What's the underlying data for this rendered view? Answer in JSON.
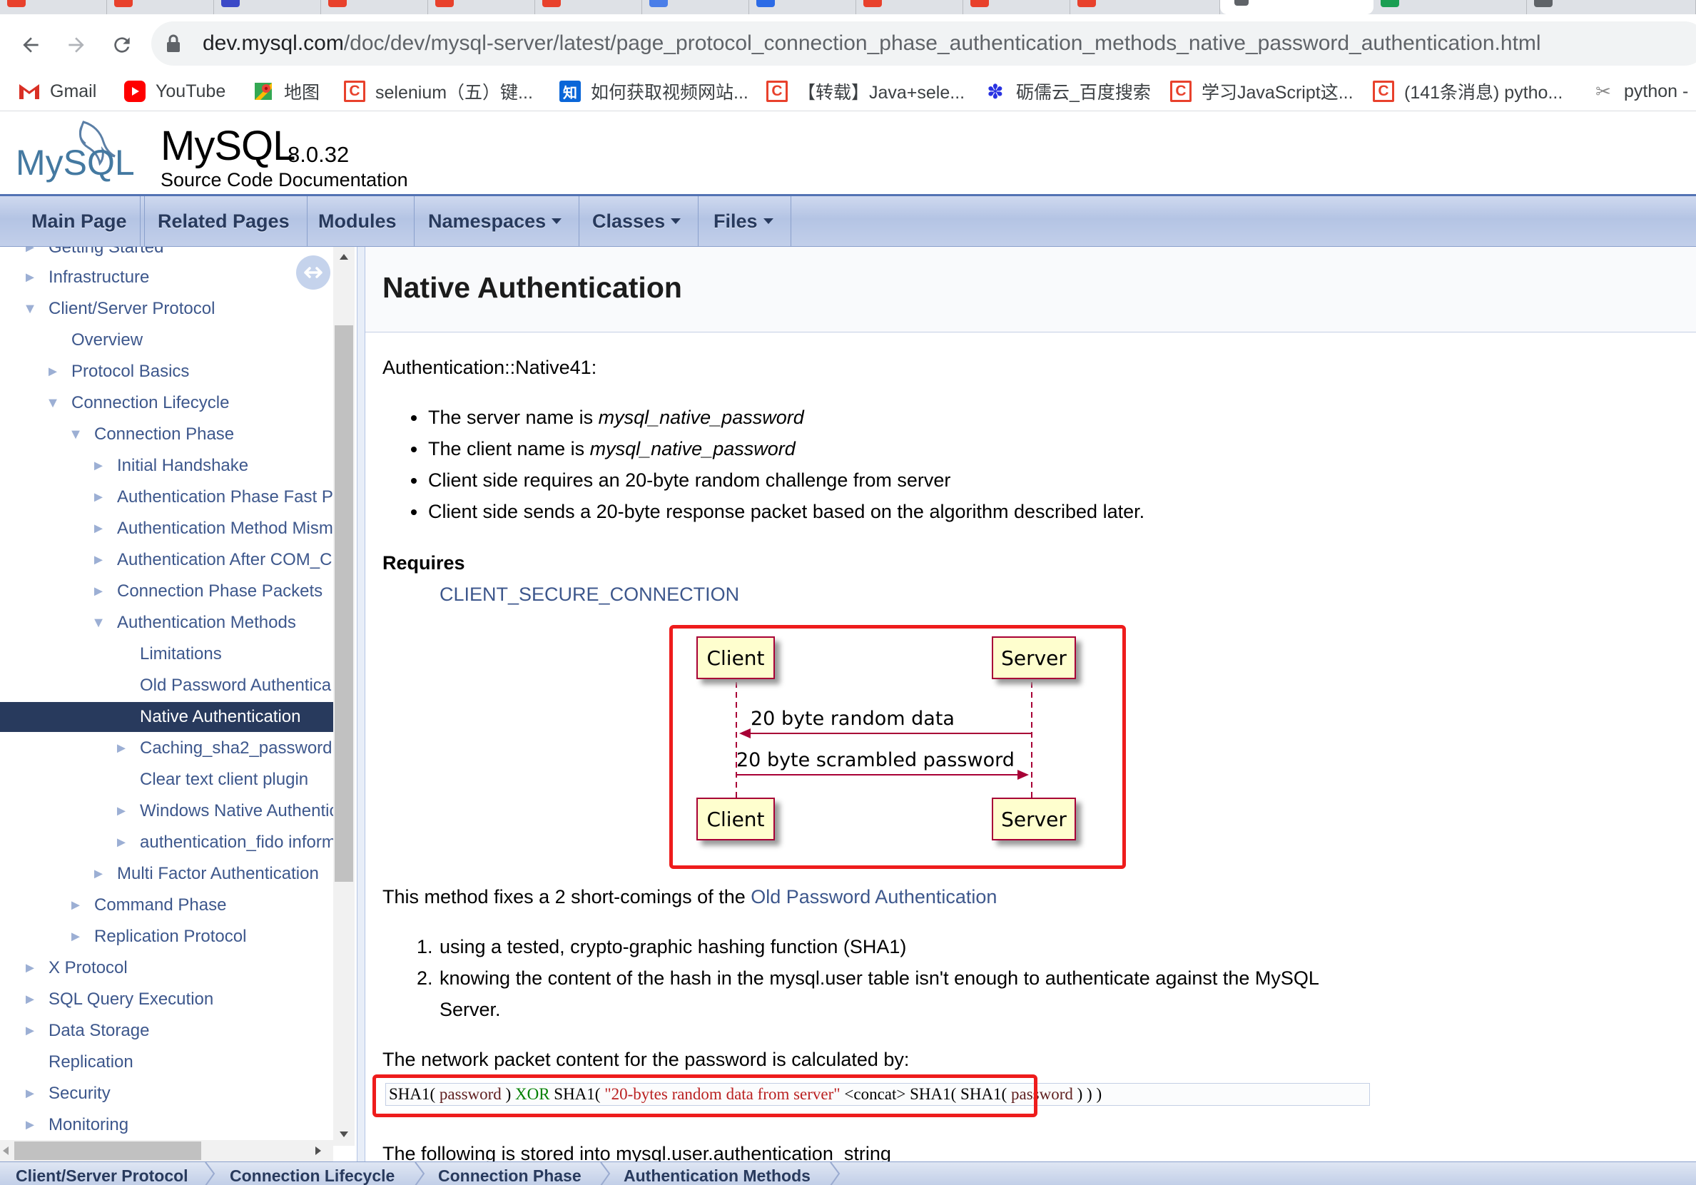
{
  "browser": {
    "url_host": "dev.mysql.com",
    "url_path": "/doc/dev/mysql-server/latest/page_protocol_connection_phase_authentication_methods_native_password_authentication.html",
    "bookmarks": [
      {
        "label": "Gmail",
        "icon": "gmail-icon"
      },
      {
        "label": "YouTube",
        "icon": "youtube-icon"
      },
      {
        "label": "地图",
        "icon": "maps-icon"
      },
      {
        "label": "selenium（五）键...",
        "icon": "csdn-icon"
      },
      {
        "label": "如何获取视频网站...",
        "icon": "zhihu-icon"
      },
      {
        "label": "【转载】Java+sele...",
        "icon": "csdn-icon"
      },
      {
        "label": "砺儒云_百度搜索",
        "icon": "baidu-icon"
      },
      {
        "label": "学习JavaScript这...",
        "icon": "csdn-icon"
      },
      {
        "label": "(141条消息) pytho...",
        "icon": "csdn-icon"
      },
      {
        "label": "python -",
        "icon": "python-icon"
      }
    ]
  },
  "header": {
    "logo_text": "MySQL",
    "project_name": "MySQL",
    "project_version": "8.0.32",
    "project_brief": "Source Code Documentation"
  },
  "menu": [
    "Main Page",
    "Related Pages",
    "Modules",
    "Namespaces",
    "Classes",
    "Files"
  ],
  "sidenav": [
    {
      "label": "Getting Started"
    },
    {
      "label": "Infrastructure"
    },
    {
      "label": "Client/Server Protocol"
    },
    {
      "label": "Overview"
    },
    {
      "label": "Protocol Basics"
    },
    {
      "label": "Connection Lifecycle"
    },
    {
      "label": "Connection Phase"
    },
    {
      "label": "Initial Handshake"
    },
    {
      "label": "Authentication Phase Fast P"
    },
    {
      "label": "Authentication Method Mism"
    },
    {
      "label": "Authentication After COM_C"
    },
    {
      "label": "Connection Phase Packets"
    },
    {
      "label": "Authentication Methods"
    },
    {
      "label": "Limitations"
    },
    {
      "label": "Old Password Authentica"
    },
    {
      "label": "Native Authentication"
    },
    {
      "label": "Caching_sha2_password"
    },
    {
      "label": "Clear text client plugin"
    },
    {
      "label": "Windows Native Authentic"
    },
    {
      "label": "authentication_fido inform"
    },
    {
      "label": "Multi Factor Authentication"
    },
    {
      "label": "Command Phase"
    },
    {
      "label": "Replication Protocol"
    },
    {
      "label": "X Protocol"
    },
    {
      "label": "SQL Query Execution"
    },
    {
      "label": "Data Storage"
    },
    {
      "label": "Replication"
    },
    {
      "label": "Security"
    },
    {
      "label": "Monitoring"
    }
  ],
  "content": {
    "title": "Native Authentication",
    "intro": "Authentication::Native41:",
    "bullets": [
      {
        "pre": "The server name is ",
        "em": "mysql_native_password"
      },
      {
        "pre": "The client name is ",
        "em": "mysql_native_password"
      },
      {
        "pre": "Client side requires an 20-byte random challenge from server",
        "em": ""
      },
      {
        "pre": "Client side sends a 20-byte response packet based on the algorithm described later.",
        "em": ""
      }
    ],
    "requires_label": "Requires",
    "requires_link": "CLIENT_SECURE_CONNECTION",
    "diagram": {
      "actor_left": "Client",
      "actor_right": "Server",
      "msg1": "20 byte random data",
      "msg2": "20 byte scrambled password"
    },
    "fixes_pre": "This method fixes a 2 short-comings of the ",
    "fixes_link": "Old Password Authentication",
    "ordered": [
      {
        "num": "1.",
        "text": "using a tested, crypto-graphic hashing function (SHA1)"
      },
      {
        "num": "2.",
        "text": "knowing the content of the hash in the mysql.user table isn't enough to authenticate against the MySQL"
      }
    ],
    "ordered_cont": "Server.",
    "calc_intro": "The network packet content for the password is calculated by:",
    "code": {
      "f1": "SHA1( ",
      "p1": "password",
      "f2": " ) ",
      "kw": "XOR",
      "f3": " SHA1( ",
      "str": "\"20-bytes random data from server\"",
      "f4": " <concat> SHA1( SHA1( ",
      "p2": "password",
      "f5": " ) ) )"
    },
    "stored_text": "The following is stored into mysql.user.authentication_string"
  },
  "breadcrumbs": [
    "Client/Server Protocol",
    "Connection Lifecycle",
    "Connection Phase",
    "Authentication Methods"
  ],
  "colors": {
    "link": "#3d578c",
    "selected": "#283a5d",
    "highlight": "#ee1c1c"
  }
}
